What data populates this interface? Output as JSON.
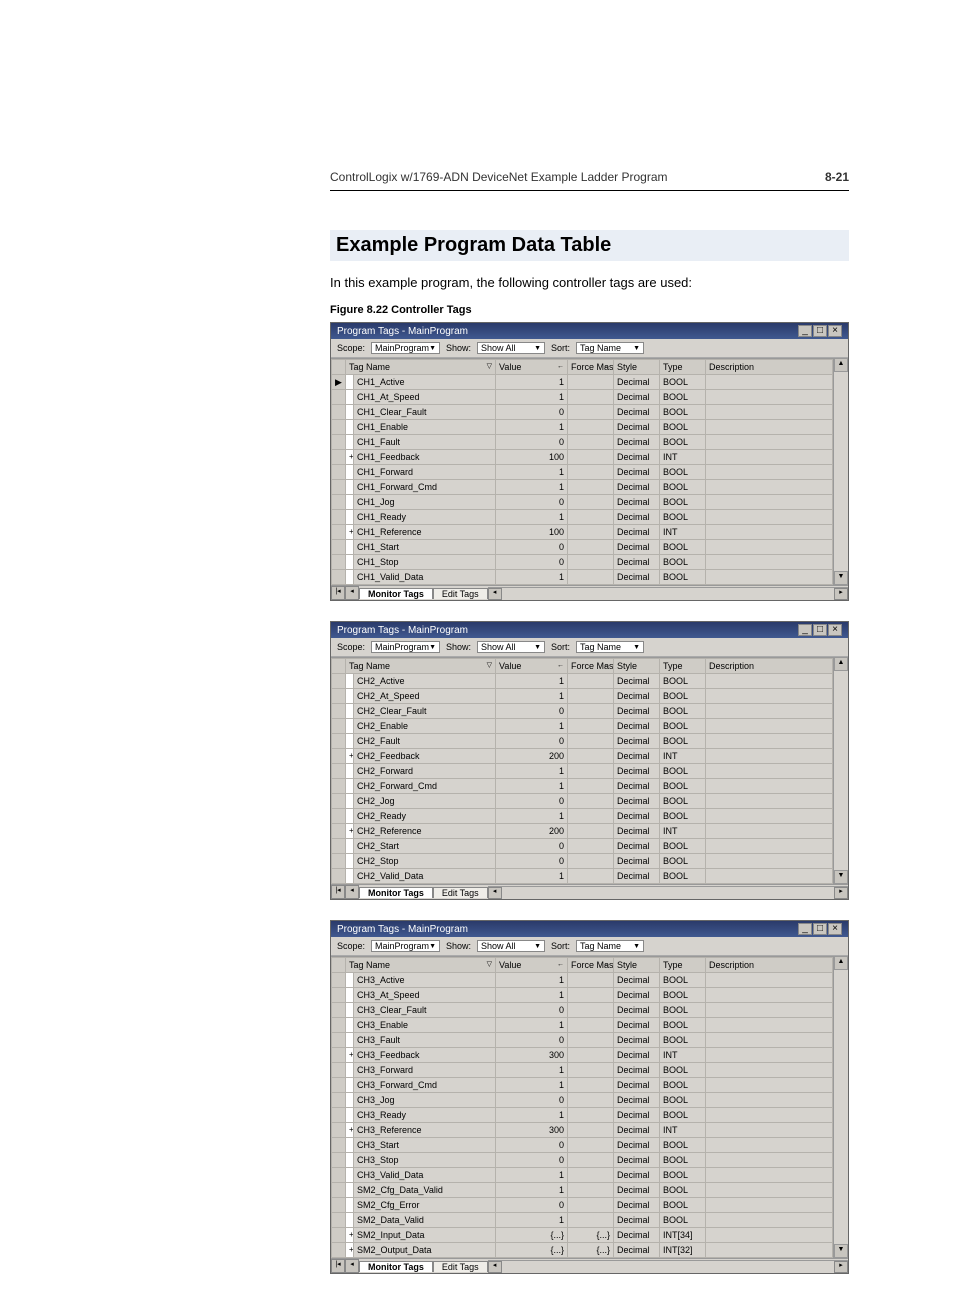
{
  "runhead": {
    "title": "ControlLogix w/1769-ADN DeviceNet Example Ladder Program",
    "pagenum": "8-21"
  },
  "section_heading": "Example Program Data Table",
  "intro_text": "In this example program, the following controller tags are used:",
  "figure_caption": "Figure 8.22    Controller Tags",
  "window_title_prefix": "Program Tags - MainProgram",
  "toolbar": {
    "scope_label": "Scope:",
    "scope_value": "MainProgram",
    "show_label": "Show:",
    "show_value": "Show All",
    "sort_label": "Sort:",
    "sort_value": "Tag Name"
  },
  "columns": {
    "name": "Tag Name",
    "value": "Value",
    "force": "Force Mask",
    "style": "Style",
    "type": "Type",
    "desc": "Description"
  },
  "tabs": {
    "monitor": "Monitor Tags",
    "edit": "Edit Tags"
  },
  "tables": [
    {
      "selected_row": 0,
      "rows": [
        {
          "exp": "",
          "name": "CH1_Active",
          "value": "1",
          "force": "",
          "style": "Decimal",
          "type": "BOOL"
        },
        {
          "exp": "",
          "name": "CH1_At_Speed",
          "value": "1",
          "force": "",
          "style": "Decimal",
          "type": "BOOL"
        },
        {
          "exp": "",
          "name": "CH1_Clear_Fault",
          "value": "0",
          "force": "",
          "style": "Decimal",
          "type": "BOOL"
        },
        {
          "exp": "",
          "name": "CH1_Enable",
          "value": "1",
          "force": "",
          "style": "Decimal",
          "type": "BOOL"
        },
        {
          "exp": "",
          "name": "CH1_Fault",
          "value": "0",
          "force": "",
          "style": "Decimal",
          "type": "BOOL"
        },
        {
          "exp": "+",
          "name": "CH1_Feedback",
          "value": "100",
          "force": "",
          "style": "Decimal",
          "type": "INT"
        },
        {
          "exp": "",
          "name": "CH1_Forward",
          "value": "1",
          "force": "",
          "style": "Decimal",
          "type": "BOOL"
        },
        {
          "exp": "",
          "name": "CH1_Forward_Cmd",
          "value": "1",
          "force": "",
          "style": "Decimal",
          "type": "BOOL"
        },
        {
          "exp": "",
          "name": "CH1_Jog",
          "value": "0",
          "force": "",
          "style": "Decimal",
          "type": "BOOL"
        },
        {
          "exp": "",
          "name": "CH1_Ready",
          "value": "1",
          "force": "",
          "style": "Decimal",
          "type": "BOOL"
        },
        {
          "exp": "+",
          "name": "CH1_Reference",
          "value": "100",
          "force": "",
          "style": "Decimal",
          "type": "INT"
        },
        {
          "exp": "",
          "name": "CH1_Start",
          "value": "0",
          "force": "",
          "style": "Decimal",
          "type": "BOOL"
        },
        {
          "exp": "",
          "name": "CH1_Stop",
          "value": "0",
          "force": "",
          "style": "Decimal",
          "type": "BOOL"
        },
        {
          "exp": "",
          "name": "CH1_Valid_Data",
          "value": "1",
          "force": "",
          "style": "Decimal",
          "type": "BOOL"
        }
      ]
    },
    {
      "selected_row": -1,
      "rows": [
        {
          "exp": "",
          "name": "CH2_Active",
          "value": "1",
          "force": "",
          "style": "Decimal",
          "type": "BOOL"
        },
        {
          "exp": "",
          "name": "CH2_At_Speed",
          "value": "1",
          "force": "",
          "style": "Decimal",
          "type": "BOOL"
        },
        {
          "exp": "",
          "name": "CH2_Clear_Fault",
          "value": "0",
          "force": "",
          "style": "Decimal",
          "type": "BOOL"
        },
        {
          "exp": "",
          "name": "CH2_Enable",
          "value": "1",
          "force": "",
          "style": "Decimal",
          "type": "BOOL"
        },
        {
          "exp": "",
          "name": "CH2_Fault",
          "value": "0",
          "force": "",
          "style": "Decimal",
          "type": "BOOL"
        },
        {
          "exp": "+",
          "name": "CH2_Feedback",
          "value": "200",
          "force": "",
          "style": "Decimal",
          "type": "INT"
        },
        {
          "exp": "",
          "name": "CH2_Forward",
          "value": "1",
          "force": "",
          "style": "Decimal",
          "type": "BOOL"
        },
        {
          "exp": "",
          "name": "CH2_Forward_Cmd",
          "value": "1",
          "force": "",
          "style": "Decimal",
          "type": "BOOL"
        },
        {
          "exp": "",
          "name": "CH2_Jog",
          "value": "0",
          "force": "",
          "style": "Decimal",
          "type": "BOOL"
        },
        {
          "exp": "",
          "name": "CH2_Ready",
          "value": "1",
          "force": "",
          "style": "Decimal",
          "type": "BOOL"
        },
        {
          "exp": "+",
          "name": "CH2_Reference",
          "value": "200",
          "force": "",
          "style": "Decimal",
          "type": "INT"
        },
        {
          "exp": "",
          "name": "CH2_Start",
          "value": "0",
          "force": "",
          "style": "Decimal",
          "type": "BOOL"
        },
        {
          "exp": "",
          "name": "CH2_Stop",
          "value": "0",
          "force": "",
          "style": "Decimal",
          "type": "BOOL"
        },
        {
          "exp": "",
          "name": "CH2_Valid_Data",
          "value": "1",
          "force": "",
          "style": "Decimal",
          "type": "BOOL"
        }
      ]
    },
    {
      "selected_row": -1,
      "rows": [
        {
          "exp": "",
          "name": "CH3_Active",
          "value": "1",
          "force": "",
          "style": "Decimal",
          "type": "BOOL"
        },
        {
          "exp": "",
          "name": "CH3_At_Speed",
          "value": "1",
          "force": "",
          "style": "Decimal",
          "type": "BOOL"
        },
        {
          "exp": "",
          "name": "CH3_Clear_Fault",
          "value": "0",
          "force": "",
          "style": "Decimal",
          "type": "BOOL"
        },
        {
          "exp": "",
          "name": "CH3_Enable",
          "value": "1",
          "force": "",
          "style": "Decimal",
          "type": "BOOL"
        },
        {
          "exp": "",
          "name": "CH3_Fault",
          "value": "0",
          "force": "",
          "style": "Decimal",
          "type": "BOOL"
        },
        {
          "exp": "+",
          "name": "CH3_Feedback",
          "value": "300",
          "force": "",
          "style": "Decimal",
          "type": "INT"
        },
        {
          "exp": "",
          "name": "CH3_Forward",
          "value": "1",
          "force": "",
          "style": "Decimal",
          "type": "BOOL"
        },
        {
          "exp": "",
          "name": "CH3_Forward_Cmd",
          "value": "1",
          "force": "",
          "style": "Decimal",
          "type": "BOOL"
        },
        {
          "exp": "",
          "name": "CH3_Jog",
          "value": "0",
          "force": "",
          "style": "Decimal",
          "type": "BOOL"
        },
        {
          "exp": "",
          "name": "CH3_Ready",
          "value": "1",
          "force": "",
          "style": "Decimal",
          "type": "BOOL"
        },
        {
          "exp": "+",
          "name": "CH3_Reference",
          "value": "300",
          "force": "",
          "style": "Decimal",
          "type": "INT"
        },
        {
          "exp": "",
          "name": "CH3_Start",
          "value": "0",
          "force": "",
          "style": "Decimal",
          "type": "BOOL"
        },
        {
          "exp": "",
          "name": "CH3_Stop",
          "value": "0",
          "force": "",
          "style": "Decimal",
          "type": "BOOL"
        },
        {
          "exp": "",
          "name": "CH3_Valid_Data",
          "value": "1",
          "force": "",
          "style": "Decimal",
          "type": "BOOL"
        },
        {
          "exp": "",
          "name": "SM2_Cfg_Data_Valid",
          "value": "1",
          "force": "",
          "style": "Decimal",
          "type": "BOOL"
        },
        {
          "exp": "",
          "name": "SM2_Cfg_Error",
          "value": "0",
          "force": "",
          "style": "Decimal",
          "type": "BOOL"
        },
        {
          "exp": "",
          "name": "SM2_Data_Valid",
          "value": "1",
          "force": "",
          "style": "Decimal",
          "type": "BOOL"
        },
        {
          "exp": "+",
          "name": "SM2_Input_Data",
          "value": "{...}",
          "force": "{...}",
          "style": "Decimal",
          "type": "INT[34]"
        },
        {
          "exp": "+",
          "name": "SM2_Output_Data",
          "value": "{...}",
          "force": "{...}",
          "style": "Decimal",
          "type": "INT[32]"
        }
      ]
    }
  ]
}
